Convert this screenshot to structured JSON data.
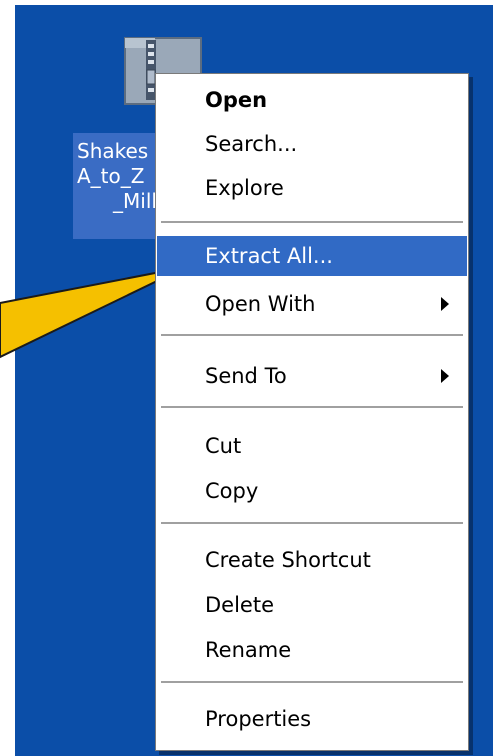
{
  "desktop": {
    "background_color": "#0b4ea8",
    "icon": {
      "name": "zip-folder-icon",
      "label_lines": [
        "Shakes",
        "A_to_Z",
        "_Mill"
      ]
    }
  },
  "context_menu": {
    "selected_color": "#316ac5",
    "items": [
      {
        "label": "Open"
      },
      {
        "label": "Search..."
      },
      {
        "label": "Explore"
      },
      {
        "label": "Extract All..."
      },
      {
        "label": "Open With"
      },
      {
        "label": "Send To"
      },
      {
        "label": "Cut"
      },
      {
        "label": "Copy"
      },
      {
        "label": "Create Shortcut"
      },
      {
        "label": "Delete"
      },
      {
        "label": "Rename"
      },
      {
        "label": "Properties"
      }
    ]
  },
  "callout": {
    "color": "#f5c000",
    "icon": "callout-arrow"
  }
}
